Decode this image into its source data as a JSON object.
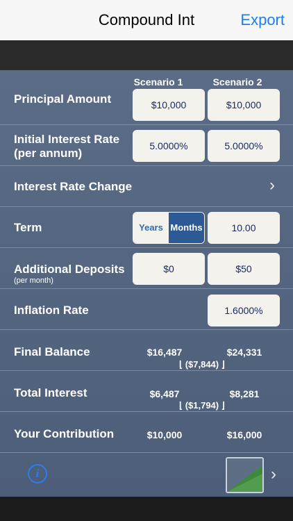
{
  "nav": {
    "title": "Compound Int",
    "export_label": "Export"
  },
  "columns": {
    "scenario1": "Scenario 1",
    "scenario2": "Scenario 2"
  },
  "principal": {
    "label": "Principal Amount",
    "s1": "$10,000",
    "s2": "$10,000"
  },
  "interest": {
    "label_line1": "Initial Interest Rate",
    "label_line2": "(per annum)",
    "s1": "5.0000%",
    "s2": "5.0000%"
  },
  "rate_change": {
    "label": "Interest Rate Change"
  },
  "term": {
    "label": "Term",
    "years_label": "Years",
    "months_label": "Months",
    "selected": "Months",
    "value": "10.00"
  },
  "deposits": {
    "label": "Additional Deposits",
    "sublabel": "(per month)",
    "s1": "$0",
    "s2": "$50"
  },
  "inflation": {
    "label": "Inflation Rate",
    "value": "1.6000%"
  },
  "final_balance": {
    "label": "Final Balance",
    "s1": "$16,487",
    "s2": "$24,331",
    "diff": "($7,844)"
  },
  "total_interest": {
    "label": "Total Interest",
    "s1": "$6,487",
    "s2": "$8,281",
    "diff": "($1,794)"
  },
  "contribution": {
    "label": "Your Contribution",
    "s1": "$10,000",
    "s2": "$16,000"
  },
  "toolbar": {
    "info_glyph": "i",
    "chevron": "›"
  },
  "colors": {
    "accent": "#1a7ef5",
    "panel": "#53647e",
    "box": "#f4f2ed",
    "segment_selected": "#2d5a94"
  },
  "icons": [
    "info-icon",
    "chart-thumbnail-icon",
    "chevron-right-icon"
  ]
}
